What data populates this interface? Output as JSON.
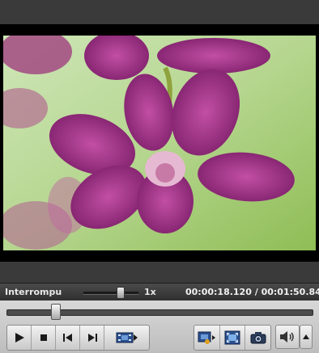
{
  "status": {
    "state_label": "Interrompu",
    "speed_label": "1x",
    "speed_level": 0.67,
    "current_time": "00:00:18.120",
    "separator": "/",
    "total_time": "00:01:50.840"
  },
  "seek": {
    "position_fraction": 0.16
  },
  "icons": {
    "play": "play-icon",
    "stop": "stop-icon",
    "previous": "skip-previous-icon",
    "next": "skip-next-icon",
    "playlist": "film-playlist-icon",
    "video_effects": "video-effects-icon",
    "fullscreen": "fullscreen-icon",
    "snapshot": "camera-icon",
    "volume": "speaker-icon",
    "volume_menu": "triangle-up-icon"
  },
  "colors": {
    "video_bg": "#000000",
    "status_bg": "#3a3a3a",
    "controls_bg": "#cfcfcf"
  }
}
